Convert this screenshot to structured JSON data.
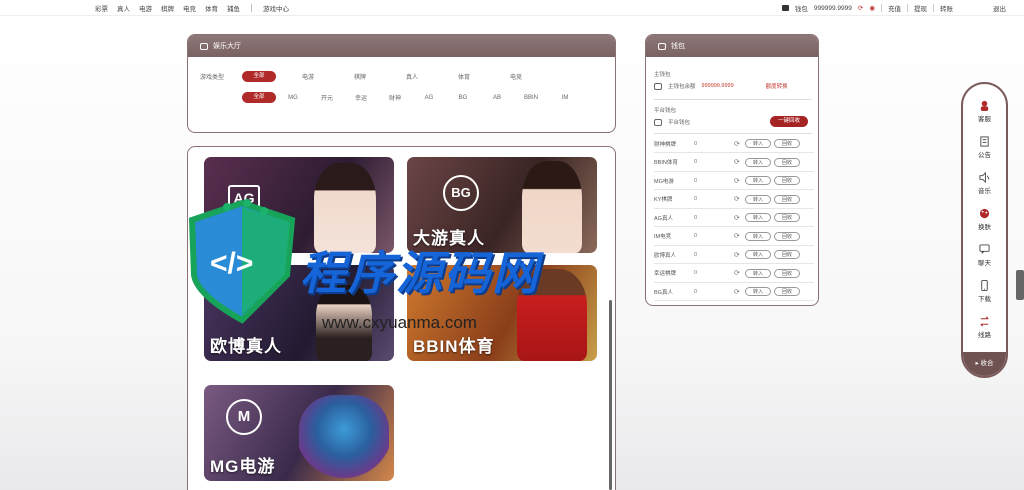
{
  "topbar": {
    "nav": [
      "彩票",
      "真人",
      "电游",
      "棋牌",
      "电竞",
      "体育",
      "捕鱼",
      "游戏中心"
    ],
    "balance_label": "钱包",
    "balance_value": "999999.9999",
    "right_links": [
      "充值",
      "提现",
      "转账"
    ],
    "logout": "退出"
  },
  "lobby": {
    "title": "娱乐大厅",
    "filter_label": "游戏类型",
    "types": [
      "全部",
      "电游",
      "棋牌",
      "真人",
      "体育",
      "电竞"
    ],
    "platforms": [
      "全部",
      "MG",
      "开元",
      "幸运",
      "财神",
      "AG",
      "BG",
      "AB",
      "BBIN",
      "IM"
    ]
  },
  "games": [
    {
      "title": "AG真人",
      "brand": "AG",
      "bg": "#4a2c43"
    },
    {
      "title": "大游真人",
      "brand": "BG",
      "bg": "#5b3a3e"
    },
    {
      "title": "欧博真人",
      "brand": "",
      "bg": "#3d2b4a"
    },
    {
      "title": "BBIN体育",
      "brand": "",
      "bg": "#b0622a"
    },
    {
      "title": "MG电游",
      "brand": "M",
      "bg": "#6a4c6e"
    }
  ],
  "wallet": {
    "title": "钱包",
    "main_section": "主钱包",
    "main_label": "主钱包余额",
    "main_value": "999999.9999",
    "main_action": "额度转换",
    "platform_section": "平台钱包",
    "platform_label": "平台钱包",
    "recover_all": "一键回收",
    "rows": [
      {
        "name": "财神棋牌",
        "amount": "0"
      },
      {
        "name": "BBIN体育",
        "amount": "0"
      },
      {
        "name": "MG电游",
        "amount": "0"
      },
      {
        "name": "KY棋牌",
        "amount": "0"
      },
      {
        "name": "AG真人",
        "amount": "0"
      },
      {
        "name": "IM电竞",
        "amount": "0"
      },
      {
        "name": "欧博真人",
        "amount": "0"
      },
      {
        "name": "幸运棋牌",
        "amount": "0"
      },
      {
        "name": "BG真人",
        "amount": "0"
      }
    ],
    "transfer_in": "转入",
    "transfer_out": "回收"
  },
  "sidebar": {
    "items": [
      "客服",
      "公告",
      "音乐",
      "换肤",
      "聊天",
      "下载",
      "线路"
    ],
    "collapse": "收合"
  },
  "watermark": {
    "text": "程序源码网",
    "url": "www.cxyuanma.com"
  }
}
